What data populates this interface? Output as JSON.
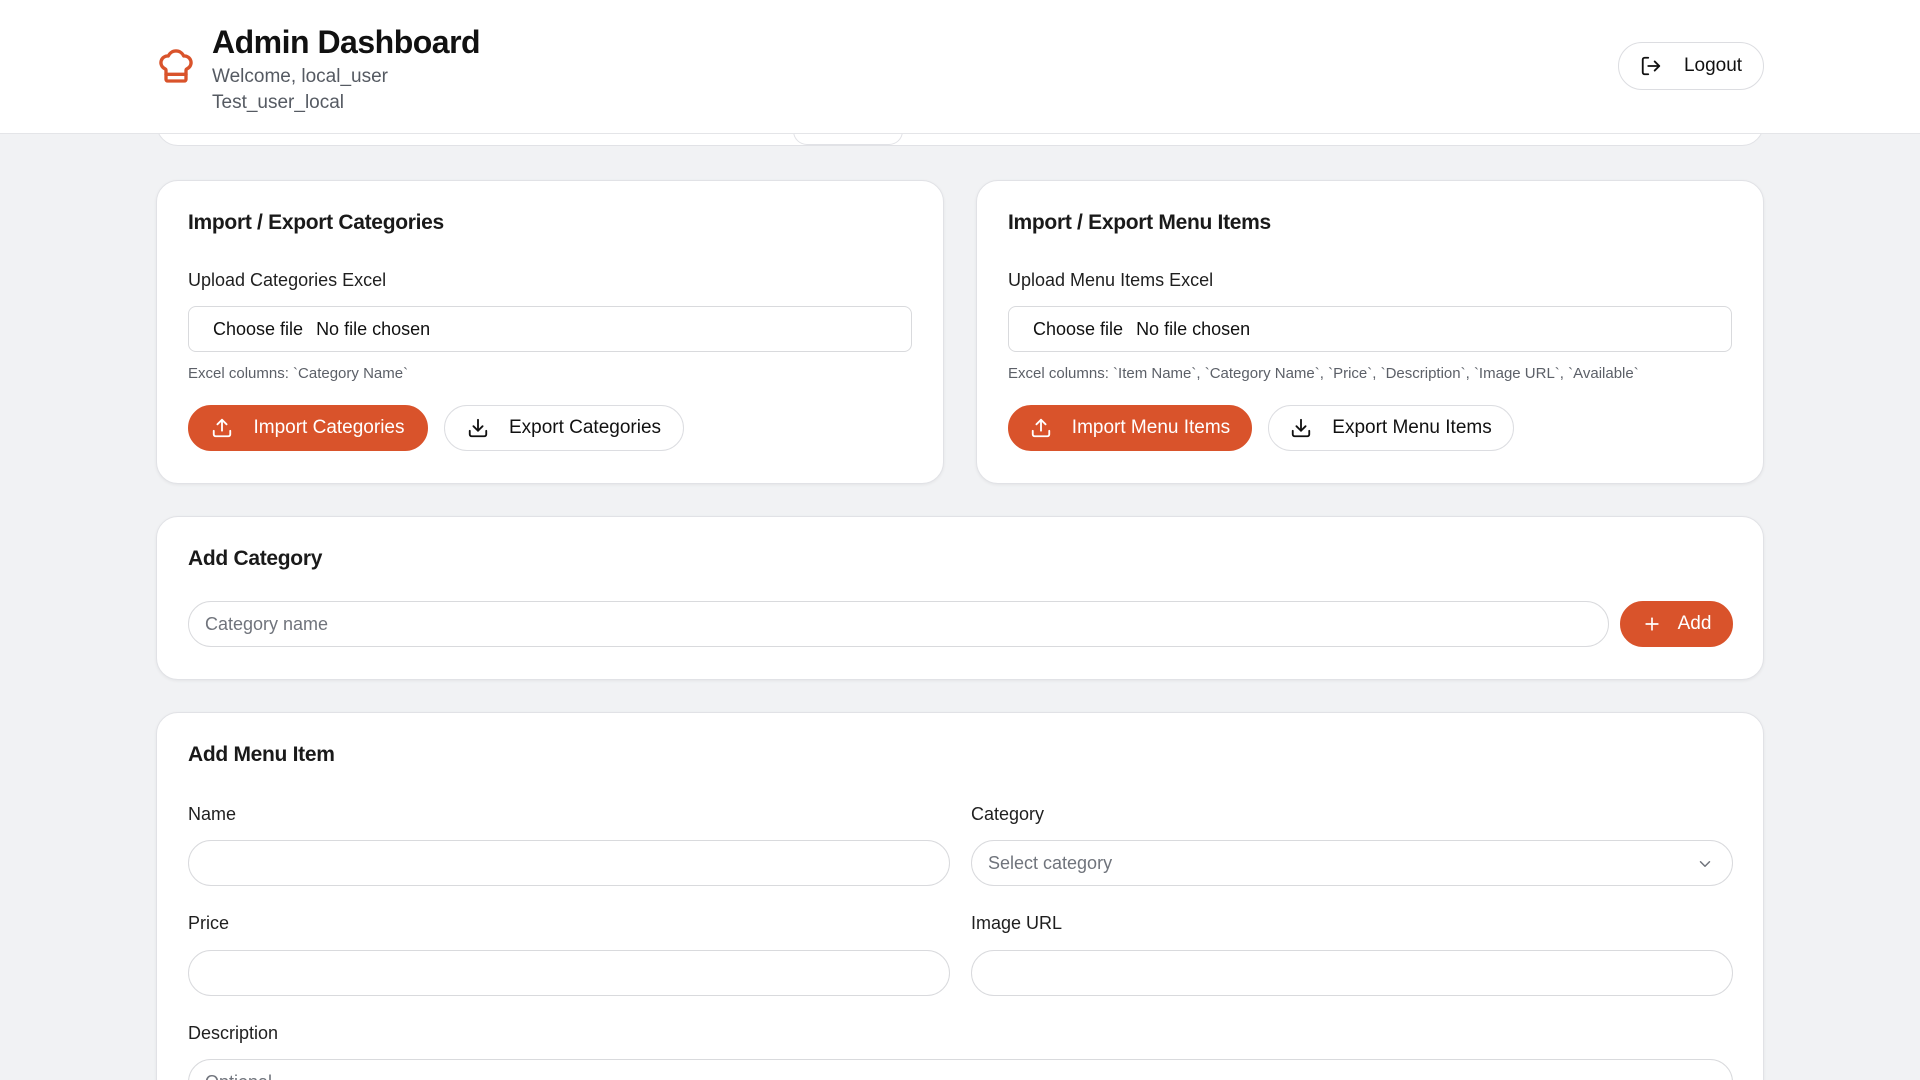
{
  "header": {
    "title": "Admin Dashboard",
    "welcome": "Welcome, local_user",
    "username": "Test_user_local",
    "logout_label": "Logout",
    "brand_color": "#d9532b"
  },
  "import_categories": {
    "title": "Import / Export Categories",
    "upload_label": "Upload Categories Excel",
    "file_button": "Choose file",
    "file_status": "No file chosen",
    "hint": "Excel columns: `Category Name`",
    "import_label": "Import Categories",
    "export_label": "Export Categories"
  },
  "import_items": {
    "title": "Import / Export Menu Items",
    "upload_label": "Upload Menu Items Excel",
    "file_button": "Choose file",
    "file_status": "No file chosen",
    "hint": "Excel columns: `Item Name`, `Category Name`, `Price`, `Description`, `Image URL`, `Available`",
    "import_label": "Import Menu Items",
    "export_label": "Export Menu Items"
  },
  "add_category": {
    "title": "Add Category",
    "placeholder": "Category name",
    "add_label": "Add"
  },
  "add_item": {
    "title": "Add Menu Item",
    "name_label": "Name",
    "category_label": "Category",
    "category_placeholder": "Select category",
    "price_label": "Price",
    "image_label": "Image URL",
    "description_label": "Description",
    "description_placeholder": "Optional"
  },
  "icons": {
    "brand": "chef-hat-icon",
    "logout": "logout-icon",
    "upload": "upload-icon",
    "download": "download-icon",
    "plus": "plus-icon",
    "chevron": "chevron-down-icon"
  }
}
